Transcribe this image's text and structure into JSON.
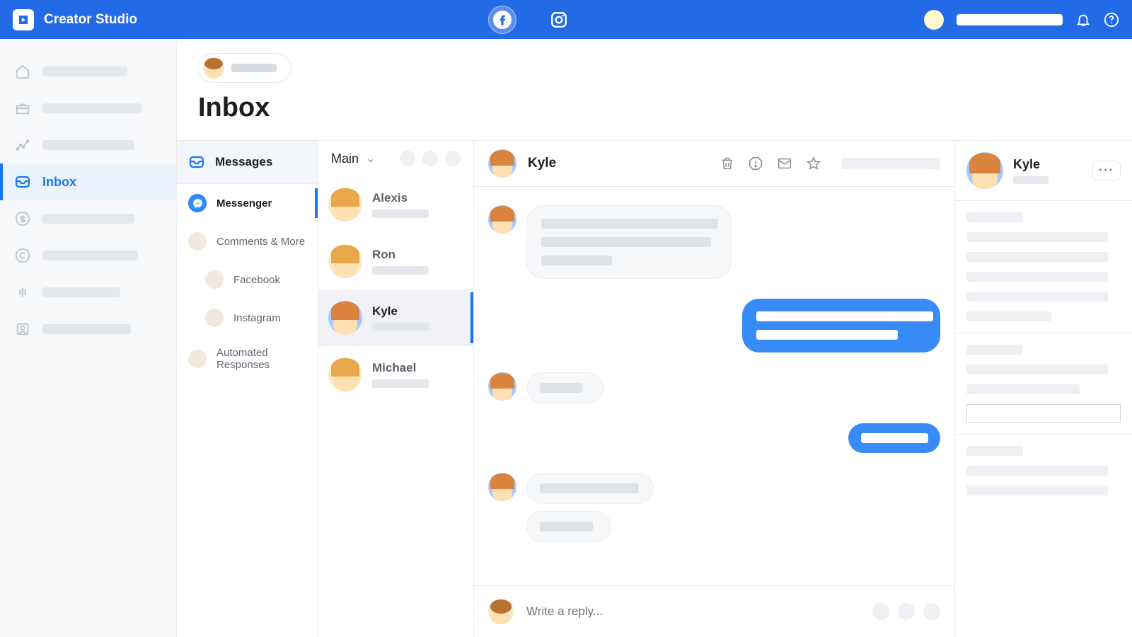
{
  "topbar": {
    "title": "Creator Studio",
    "platforms": {
      "facebook": "facebook-icon",
      "instagram": "instagram-icon"
    }
  },
  "nav": {
    "items": [
      {
        "id": "home",
        "icon": "home-icon"
      },
      {
        "id": "content",
        "icon": "briefcase-icon"
      },
      {
        "id": "insights",
        "icon": "chart-icon"
      },
      {
        "id": "inbox",
        "icon": "inbox-icon",
        "label": "Inbox"
      },
      {
        "id": "monetize",
        "icon": "dollar-icon"
      },
      {
        "id": "rights",
        "icon": "copyright-icon"
      },
      {
        "id": "sound",
        "icon": "audio-icon"
      },
      {
        "id": "pages",
        "icon": "pages-icon"
      }
    ],
    "active": "inbox"
  },
  "page": {
    "title": "Inbox"
  },
  "folders": {
    "heading": "Messages",
    "items": [
      {
        "label": "Messenger",
        "type": "messenger"
      },
      {
        "label": "Comments & More",
        "type": "plain"
      },
      {
        "label": "Facebook",
        "type": "plain"
      },
      {
        "label": "Instagram",
        "type": "plain"
      },
      {
        "label": "Automated Responses",
        "type": "plain"
      }
    ],
    "active": 0
  },
  "threads": {
    "filter": "Main",
    "items": [
      {
        "name": "Alexis"
      },
      {
        "name": "Ron"
      },
      {
        "name": "Kyle"
      },
      {
        "name": "Michael"
      }
    ],
    "selected": 2
  },
  "conversation": {
    "with": "Kyle",
    "reply_placeholder": "Write a reply..."
  },
  "details": {
    "name": "Kyle"
  }
}
